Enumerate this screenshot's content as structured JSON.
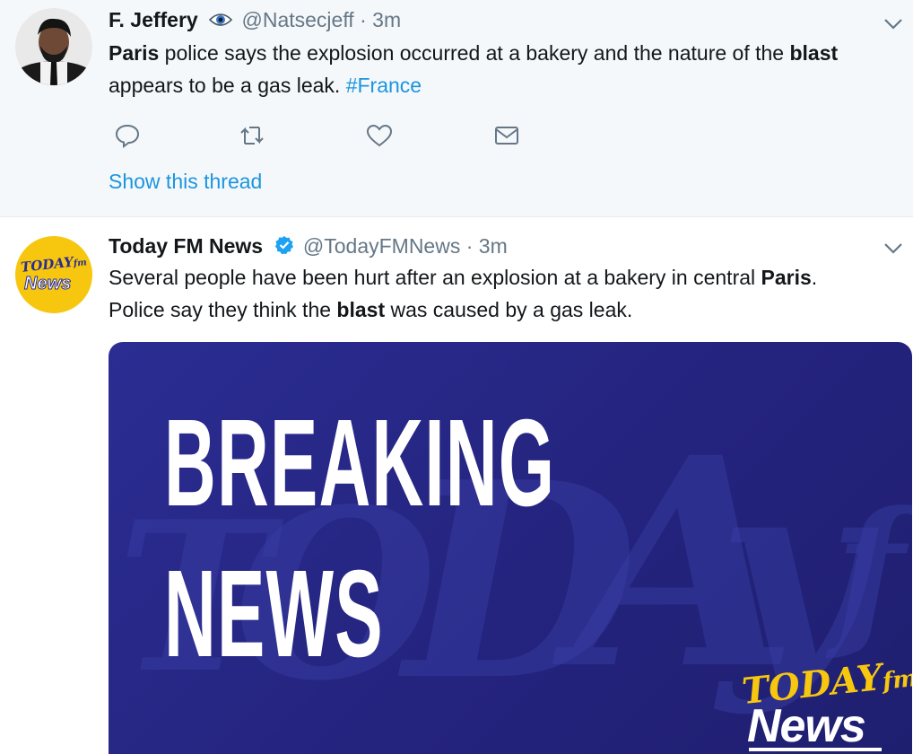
{
  "tweets": [
    {
      "author_name": "F. Jeffery",
      "author_badge": "eye-icon",
      "handle": "@Natsecjeff",
      "separator": "·",
      "time": "3m",
      "text_segments": [
        "Paris",
        " police says the explosion occurred at a bakery and the nature of the ",
        "blast",
        " appears to be a gas leak. ",
        "#France"
      ],
      "show_thread": "Show this thread"
    },
    {
      "author_name": "Today FM News",
      "author_badge": "verified-badge-icon",
      "handle": "@TodayFMNews",
      "separator": "·",
      "time": "3m",
      "text_segments": [
        "Several people have been hurt after an explosion at a bakery in central ",
        "Paris",
        ".",
        "Police say they think the ",
        "blast",
        " was caused by a gas leak."
      ],
      "avatar_text": {
        "line1": "TODAY",
        "line1_suffix": "fm",
        "line2": "News"
      },
      "media": {
        "headline_line1": "BREAKING",
        "headline_line2": "NEWS",
        "logo_line1": "TODAY",
        "logo_line1_suffix": "fm",
        "logo_line2": "News"
      }
    }
  ],
  "colors": {
    "link": "#1b95e0",
    "muted": "#657786",
    "verified": "#1da1f2",
    "media_bg": "#2b2d92",
    "brand_yellow": "#f7c70f"
  }
}
